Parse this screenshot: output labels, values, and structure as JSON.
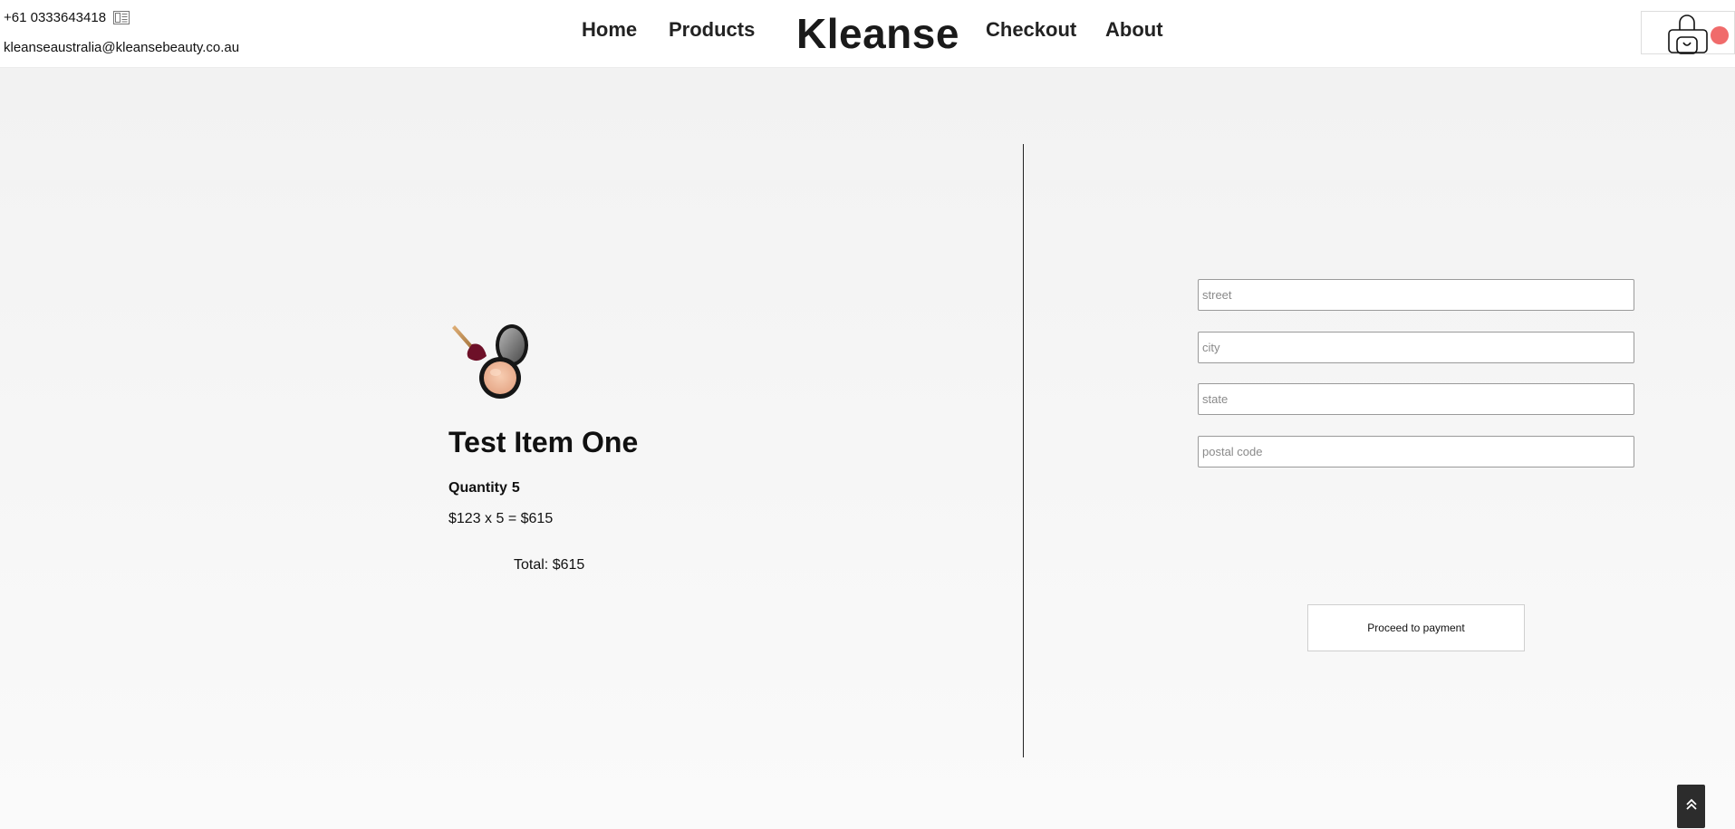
{
  "header": {
    "phone": "+61 0333643418",
    "email": "kleanseaustralia@kleansebeauty.co.au",
    "nav": {
      "home": "Home",
      "products": "Products",
      "checkout": "Checkout",
      "about": "About"
    },
    "brand": "Kleanse",
    "cart": {
      "icon": "shopping-bag-icon",
      "badge_color": "#f06b6b"
    }
  },
  "cart_item": {
    "image": "makeup-compact-brush-image",
    "name": "Test Item One",
    "quantity_label": "Quantity",
    "quantity": "5",
    "line_calc": "$123 x 5 = $615",
    "total": "Total: $615"
  },
  "address_form": {
    "street_placeholder": "street",
    "city_placeholder": "city",
    "state_placeholder": "state",
    "postal_placeholder": "postal code",
    "submit_label": "Proceed to payment"
  },
  "scroll_top": {
    "icon": "double-chevron-up-icon",
    "bg": "#2c2c2c"
  }
}
